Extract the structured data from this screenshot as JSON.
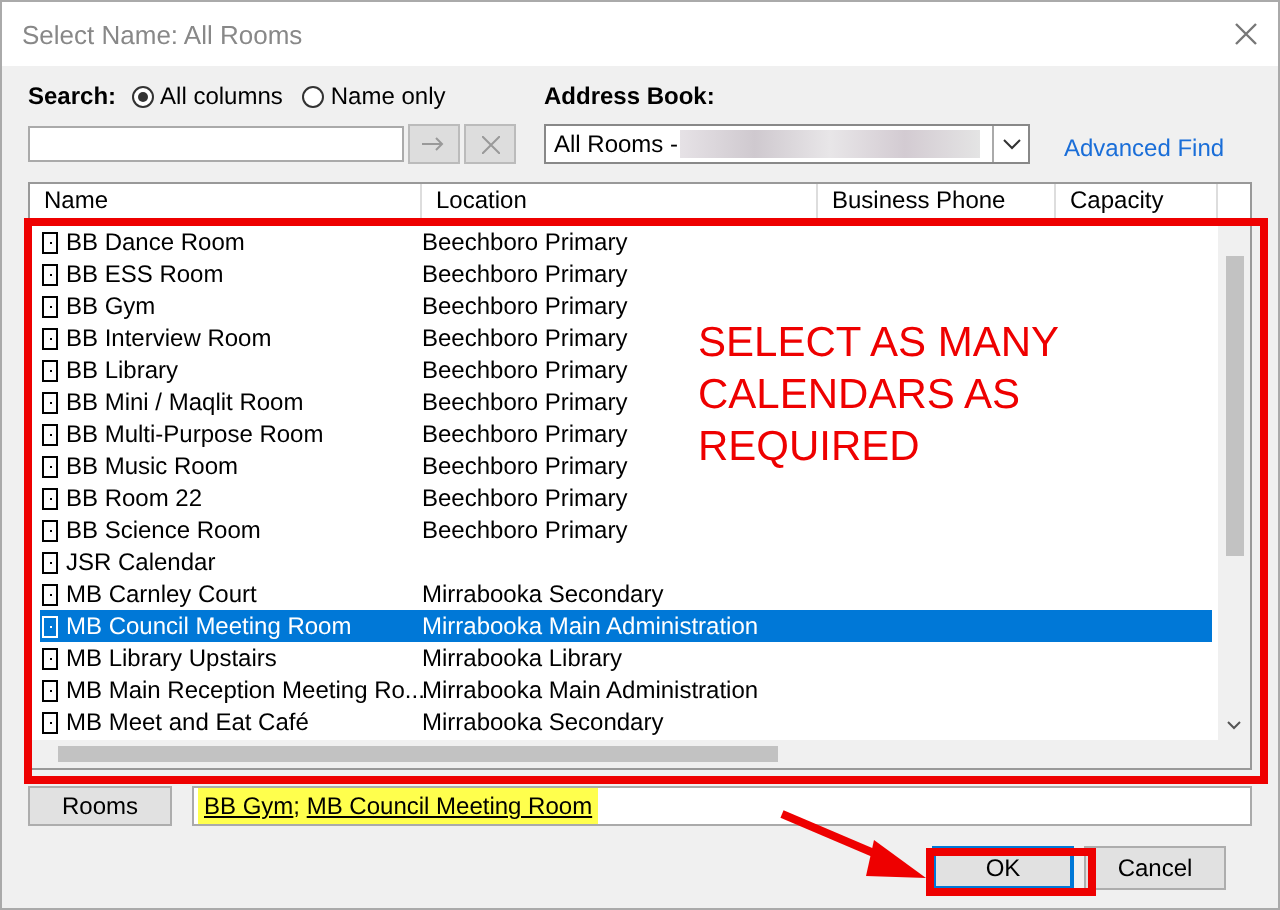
{
  "window": {
    "title": "Select Name: All Rooms"
  },
  "search": {
    "label": "Search:",
    "options": [
      {
        "label": "All columns",
        "selected": true
      },
      {
        "label": "Name only",
        "selected": false
      }
    ],
    "buttons": [
      {
        "kind": "go",
        "disabled": true
      },
      {
        "kind": "clear",
        "disabled": true
      }
    ]
  },
  "address_book": {
    "label": "Address Book:",
    "value": "All Rooms -"
  },
  "advanced_find": "Advanced Find",
  "table": {
    "columns": [
      "Name",
      "Location",
      "Business Phone",
      "Capacity"
    ],
    "rows": [
      {
        "name": "BB Dance Room",
        "location": "Beechboro Primary",
        "selected": false
      },
      {
        "name": "BB ESS Room",
        "location": "Beechboro Primary",
        "selected": false
      },
      {
        "name": "BB Gym",
        "location": "Beechboro Primary",
        "selected": false
      },
      {
        "name": "BB Interview Room",
        "location": "Beechboro Primary",
        "selected": false
      },
      {
        "name": "BB Library",
        "location": "Beechboro Primary",
        "selected": false
      },
      {
        "name": "BB Mini / Maqlit Room",
        "location": "Beechboro Primary",
        "selected": false
      },
      {
        "name": "BB Multi-Purpose Room",
        "location": "Beechboro Primary",
        "selected": false
      },
      {
        "name": "BB Music Room",
        "location": "Beechboro Primary",
        "selected": false
      },
      {
        "name": "BB Room 22",
        "location": "Beechboro Primary",
        "selected": false
      },
      {
        "name": "BB Science Room",
        "location": "Beechboro Primary",
        "selected": false
      },
      {
        "name": "JSR Calendar",
        "selected": false
      },
      {
        "name": "MB Carnley Court",
        "location": "Mirrabooka Secondary",
        "selected": false
      },
      {
        "name": "MB Council Meeting Room",
        "location": "Mirrabooka Main Administration",
        "selected": true
      },
      {
        "name": "MB Library Upstairs",
        "location": "Mirrabooka Library",
        "selected": false
      },
      {
        "name": "MB Main Reception Meeting Ro...",
        "location": "Mirrabooka Main Administration",
        "selected": false
      },
      {
        "name": "MB Meet and Eat Café",
        "location": "Mirrabooka Secondary",
        "selected": false
      }
    ]
  },
  "rooms_button": "Rooms",
  "recipients": {
    "entries": [
      "BB Gym",
      "MB Council Meeting Room"
    ],
    "separator": ";",
    "highlighted": true
  },
  "buttons": [
    {
      "label": "OK",
      "default": true
    },
    {
      "label": "Cancel",
      "default": false
    }
  ],
  "annotation": {
    "note": "SELECT AS MANY CALENDARS AS REQUIRED"
  }
}
